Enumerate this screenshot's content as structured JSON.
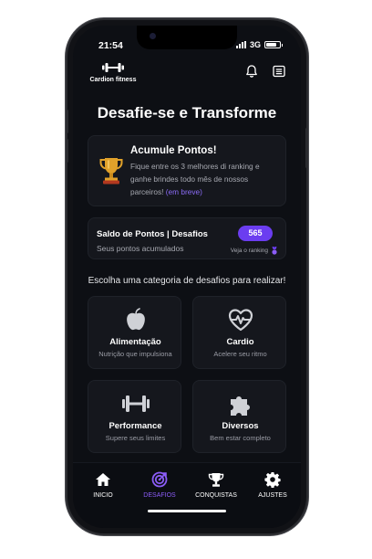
{
  "status": {
    "time": "21:54",
    "network": "3G"
  },
  "header": {
    "brand": "Cardion fitness",
    "icons": [
      "bell-icon",
      "menu-list-icon"
    ]
  },
  "title": "Desafie-se e Transforme",
  "promo": {
    "title": "Acumule Pontos!",
    "description": "Fique entre os 3 melhores di ranking e ganhe brindes todo mês de nossos parceiros!",
    "soon": "(em breve)",
    "icon": "trophy-icon"
  },
  "points": {
    "title": "Saldo de Pontos | Desafios",
    "subtitle": "Seus pontos acumulados",
    "value": "565",
    "ranking_link": "Veja o ranking"
  },
  "choose_label": "Escolha uma categoria de desafios para realizar!",
  "categories": [
    {
      "name": "Alimentação",
      "desc": "Nutrição que impulsiona",
      "icon": "apple-icon"
    },
    {
      "name": "Cardio",
      "desc": "Acelere seu ritmo",
      "icon": "heartbeat-icon"
    },
    {
      "name": "Performance",
      "desc": "Supere seus limites",
      "icon": "dumbbell-icon"
    },
    {
      "name": "Diversos",
      "desc": "Bem estar completo",
      "icon": "puzzle-icon"
    }
  ],
  "tabs": [
    {
      "label": "INICIO",
      "icon": "home-icon",
      "active": false
    },
    {
      "label": "DESAFIOS",
      "icon": "target-icon",
      "active": true
    },
    {
      "label": "CONQUISTAS",
      "icon": "trophy-icon",
      "active": false
    },
    {
      "label": "AJUSTES",
      "icon": "gear-icon",
      "active": false
    }
  ],
  "colors": {
    "accent": "#6b3df0",
    "accent_text": "#8b5cf6",
    "background": "#0d0f14",
    "card": "#15171d",
    "gold": "#e0a12a"
  }
}
